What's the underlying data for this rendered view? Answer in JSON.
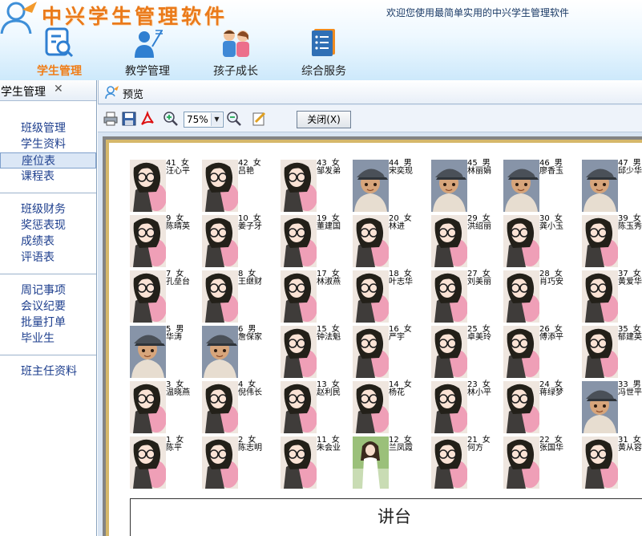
{
  "header": {
    "app_title": "中兴学生管理软件",
    "welcome": "欢迎您使用最简单实用的中兴学生管理软件",
    "modules": [
      {
        "label": "学生管理",
        "icon": "student-search-icon",
        "active": true
      },
      {
        "label": "教学管理",
        "icon": "teacher-icon",
        "active": false
      },
      {
        "label": "孩子成长",
        "icon": "family-icon",
        "active": false
      },
      {
        "label": "综合服务",
        "icon": "book-list-icon",
        "active": false
      }
    ]
  },
  "sidebar": {
    "tab_label": "学生管理",
    "tab_close": "✕",
    "groups": [
      [
        "班级管理",
        "学生资料",
        "座位表",
        "课程表"
      ],
      [
        "班级财务",
        "奖惩表现",
        "成绩表",
        "评语表"
      ],
      [
        "周记事项",
        "会议纪要",
        "批量打单",
        "毕业生"
      ],
      [
        "班主任资料"
      ]
    ],
    "selected": "座位表"
  },
  "preview": {
    "title": "预览",
    "zoom": "75%",
    "close_label": "关闭(X)",
    "toolbar_icons": [
      "print-icon",
      "save-icon",
      "pdf-icon",
      "zoom-in-icon",
      "zoom-out-icon",
      "edit-icon"
    ]
  },
  "seating": {
    "podium": "讲台",
    "rows": [
      [
        {
          "no": "41",
          "gender": "女",
          "name": "汪心平",
          "avatar": "girl"
        },
        {
          "no": "42",
          "gender": "女",
          "name": "吕艳",
          "avatar": "girl"
        },
        {
          "no": "43",
          "gender": "女",
          "name": "邹发弟",
          "avatar": "girl"
        },
        {
          "no": "44",
          "gender": "男",
          "name": "宋奕现",
          "avatar": "boy"
        },
        {
          "no": "45",
          "gender": "男",
          "name": "林丽娟",
          "avatar": "boy"
        },
        {
          "no": "46",
          "gender": "男",
          "name": "廖香玉",
          "avatar": "boy"
        },
        {
          "no": "47",
          "gender": "男",
          "name": "邱少华",
          "avatar": "boy"
        }
      ],
      [
        {
          "no": "9",
          "gender": "女",
          "name": "陈晴英",
          "avatar": "girl"
        },
        {
          "no": "10",
          "gender": "女",
          "name": "姜子牙",
          "avatar": "girl"
        },
        {
          "no": "19",
          "gender": "女",
          "name": "董建国",
          "avatar": "girl"
        },
        {
          "no": "20",
          "gender": "女",
          "name": "林进",
          "avatar": "girl"
        },
        {
          "no": "29",
          "gender": "女",
          "name": "洪绍丽",
          "avatar": "girl"
        },
        {
          "no": "30",
          "gender": "女",
          "name": "龚小玉",
          "avatar": "girl"
        },
        {
          "no": "39",
          "gender": "女",
          "name": "陈玉秀",
          "avatar": "girl"
        }
      ],
      [
        {
          "no": "7",
          "gender": "女",
          "name": "孔垒台",
          "avatar": "girl"
        },
        {
          "no": "8",
          "gender": "女",
          "name": "王继财",
          "avatar": "girl"
        },
        {
          "no": "17",
          "gender": "女",
          "name": "林淑燕",
          "avatar": "girl"
        },
        {
          "no": "18",
          "gender": "女",
          "name": "叶志华",
          "avatar": "girl"
        },
        {
          "no": "27",
          "gender": "女",
          "name": "刘美丽",
          "avatar": "girl"
        },
        {
          "no": "28",
          "gender": "女",
          "name": "肖巧安",
          "avatar": "girl"
        },
        {
          "no": "37",
          "gender": "女",
          "name": "黄爱华",
          "avatar": "girl"
        }
      ],
      [
        {
          "no": "5",
          "gender": "男",
          "name": "华涛",
          "avatar": "boy"
        },
        {
          "no": "6",
          "gender": "男",
          "name": "詹保家",
          "avatar": "boy"
        },
        {
          "no": "15",
          "gender": "女",
          "name": "钟法魁",
          "avatar": "girl"
        },
        {
          "no": "16",
          "gender": "女",
          "name": "严宇",
          "avatar": "girl"
        },
        {
          "no": "25",
          "gender": "女",
          "name": "卓美玲",
          "avatar": "girl"
        },
        {
          "no": "26",
          "gender": "女",
          "name": "傅添平",
          "avatar": "girl"
        },
        {
          "no": "35",
          "gender": "女",
          "name": "郁建英",
          "avatar": "girl"
        }
      ],
      [
        {
          "no": "3",
          "gender": "女",
          "name": "温晓燕",
          "avatar": "girl"
        },
        {
          "no": "4",
          "gender": "女",
          "name": "倪伟长",
          "avatar": "girl"
        },
        {
          "no": "13",
          "gender": "女",
          "name": "赵利民",
          "avatar": "girl"
        },
        {
          "no": "14",
          "gender": "女",
          "name": "杨花",
          "avatar": "girl"
        },
        {
          "no": "23",
          "gender": "女",
          "name": "林小平",
          "avatar": "girl"
        },
        {
          "no": "24",
          "gender": "女",
          "name": "蒋绿梦",
          "avatar": "girl"
        },
        {
          "no": "33",
          "gender": "男",
          "name": "冯世平",
          "avatar": "boy"
        }
      ],
      [
        {
          "no": "1",
          "gender": "女",
          "name": "陈平",
          "avatar": "girl"
        },
        {
          "no": "2",
          "gender": "女",
          "name": "陈志明",
          "avatar": "girl"
        },
        {
          "no": "11",
          "gender": "女",
          "name": "朱会业",
          "avatar": "girl"
        },
        {
          "no": "12",
          "gender": "女",
          "name": "兰凤霞",
          "avatar": "photo"
        },
        {
          "no": "21",
          "gender": "女",
          "name": "何方",
          "avatar": "girl"
        },
        {
          "no": "22",
          "gender": "女",
          "name": "张国华",
          "avatar": "girl"
        },
        {
          "no": "31",
          "gender": "女",
          "name": "黄从容",
          "avatar": "girl"
        }
      ]
    ]
  }
}
